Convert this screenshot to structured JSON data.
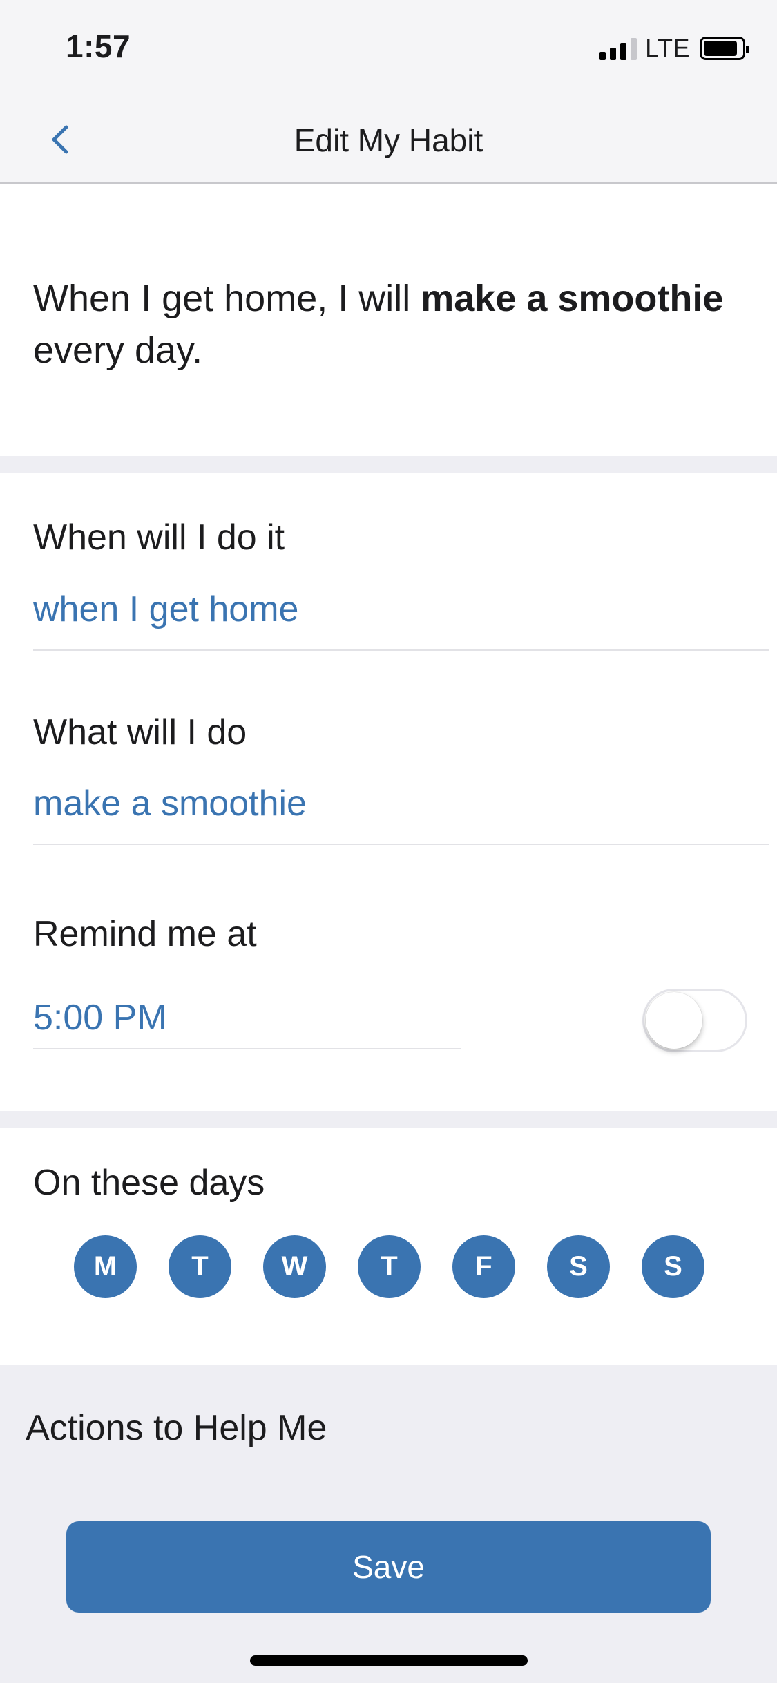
{
  "status_bar": {
    "time": "1:57",
    "network": "LTE"
  },
  "nav": {
    "title": "Edit My Habit",
    "back_icon": "chevron-left-icon"
  },
  "summary": {
    "prefix": "When I get home, I will ",
    "habit": "make a smoothie",
    "suffix": " every day."
  },
  "when": {
    "label": "When will I do it",
    "value": "when I get home"
  },
  "what": {
    "label": "What will I do",
    "value": "make a smoothie"
  },
  "reminder": {
    "label": "Remind me at",
    "value": "5:00 PM",
    "enabled": false
  },
  "days": {
    "label": "On these days",
    "items": [
      "M",
      "T",
      "W",
      "T",
      "F",
      "S",
      "S"
    ]
  },
  "actions": {
    "title": "Actions to Help Me"
  },
  "save": {
    "label": "Save"
  },
  "colors": {
    "accent": "#3a74b1",
    "separator": "#eeeef3"
  }
}
